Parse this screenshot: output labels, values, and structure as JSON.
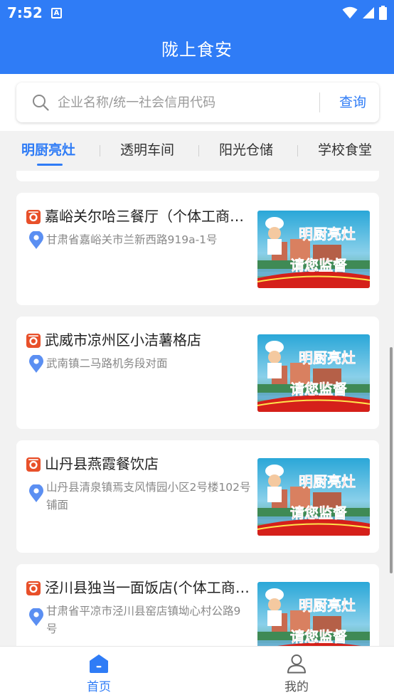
{
  "status_bar": {
    "time": "7:52",
    "notification_icon": "A"
  },
  "app": {
    "title": "陇上食安"
  },
  "search": {
    "placeholder": "企业名称/统一社会信用代码",
    "value": "",
    "button_label": "查询"
  },
  "tabs": [
    {
      "label": "明厨亮灶",
      "active": true
    },
    {
      "label": "透明车间",
      "active": false
    },
    {
      "label": "阳光仓储",
      "active": false
    },
    {
      "label": "学校食堂",
      "active": false
    }
  ],
  "thumbnail": {
    "line1": "明厨亮灶",
    "line2": "请您监督"
  },
  "listings": [
    {
      "name": "嘉峪关尔哈三餐厅（个体工商户）",
      "address": "甘肃省嘉峪关市兰新西路919a-1号"
    },
    {
      "name": "武威市凉州区小洁薯格店",
      "address": "武南镇二马路机务段对面"
    },
    {
      "name": "山丹县燕霞餐饮店",
      "address": "山丹县清泉镇焉支风情园小区2号楼102号铺面"
    },
    {
      "name": "泾川县独当一面饭店(个体工商户)",
      "address": "甘肃省平凉市泾川县窑店镇坳心村公路9号"
    }
  ],
  "bottom_nav": [
    {
      "label": "首页",
      "active": true
    },
    {
      "label": "我的",
      "active": false
    }
  ],
  "colors": {
    "primary": "#2f7cf6",
    "background": "#f2f2f2",
    "shop_icon": "#e8502a",
    "pin": "#5b8ff2"
  }
}
